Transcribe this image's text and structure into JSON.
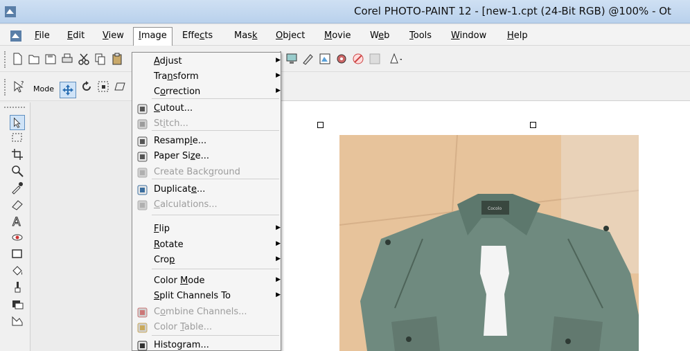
{
  "window": {
    "title": "Corel PHOTO-PAINT 12 - [new-1.cpt (24-Bit RGB) @100% - Ot"
  },
  "menubar": {
    "items": [
      {
        "label": "File",
        "key": "F",
        "rest": "ile"
      },
      {
        "label": "Edit",
        "key": "E",
        "rest": "dit"
      },
      {
        "label": "View",
        "key": "V",
        "rest": "iew"
      },
      {
        "label": "Image",
        "key": "I",
        "rest": "mage"
      },
      {
        "label": "Effects",
        "pre": "Effe",
        "key": "c",
        "rest": "ts"
      },
      {
        "label": "Mask",
        "pre": "Mas",
        "key": "k",
        "rest": ""
      },
      {
        "label": "Object",
        "key": "O",
        "rest": "bject"
      },
      {
        "label": "Movie",
        "key": "M",
        "rest": "ovie"
      },
      {
        "label": "Web",
        "pre": "W",
        "key": "e",
        "rest": "b"
      },
      {
        "label": "Tools",
        "key": "T",
        "rest": "ools"
      },
      {
        "label": "Window",
        "key": "W",
        "rest": "indow"
      },
      {
        "label": "Help",
        "key": "H",
        "rest": "elp"
      }
    ]
  },
  "toolbar2": {
    "mode_label": "Mode"
  },
  "image_menu": {
    "items": [
      {
        "pre": "",
        "key": "A",
        "rest": "djust",
        "submenu": true,
        "disabled": false
      },
      {
        "pre": "Tra",
        "key": "n",
        "rest": "sform",
        "submenu": true,
        "disabled": false
      },
      {
        "pre": "C",
        "key": "o",
        "rest": "rrection",
        "submenu": true,
        "disabled": false
      },
      {
        "pre": "",
        "key": "C",
        "rest": "utout...",
        "submenu": false,
        "disabled": false
      },
      {
        "pre": "St",
        "key": "i",
        "rest": "tch...",
        "submenu": false,
        "disabled": true
      },
      {
        "pre": "Resamp",
        "key": "l",
        "rest": "e...",
        "submenu": false,
        "disabled": false
      },
      {
        "pre": "Paper Si",
        "key": "z",
        "rest": "e...",
        "submenu": false,
        "disabled": false
      },
      {
        "pre": "Create Back",
        "key": "g",
        "rest": "round",
        "submenu": false,
        "disabled": true
      },
      {
        "pre": "Duplicat",
        "key": "e",
        "rest": "...",
        "submenu": false,
        "disabled": false
      },
      {
        "pre": "",
        "key": "C",
        "rest": "alculations...",
        "submenu": false,
        "disabled": true
      },
      {
        "pre": "",
        "key": "F",
        "rest": "lip",
        "submenu": true,
        "disabled": false
      },
      {
        "pre": "",
        "key": "R",
        "rest": "otate",
        "submenu": true,
        "disabled": false
      },
      {
        "pre": "Cro",
        "key": "p",
        "rest": "",
        "submenu": true,
        "disabled": false
      },
      {
        "pre": "Color ",
        "key": "M",
        "rest": "ode",
        "submenu": true,
        "disabled": false
      },
      {
        "pre": "",
        "key": "S",
        "rest": "plit Channels To",
        "submenu": true,
        "disabled": false
      },
      {
        "pre": "C",
        "key": "o",
        "rest": "mbine Channels...",
        "submenu": false,
        "disabled": true
      },
      {
        "pre": "Color ",
        "key": "T",
        "rest": "able...",
        "submenu": false,
        "disabled": true
      },
      {
        "pre": "",
        "key": "",
        "rest": "Histogram...",
        "submenu": false,
        "disabled": false
      }
    ]
  },
  "colors": {
    "titlebar": "#c4d8ef",
    "menu_bg": "#f5f5f5",
    "disabled_text": "#9c9c9c",
    "shirt": "#6f8a7f"
  },
  "photo": {
    "label_text": "Cocolo"
  }
}
